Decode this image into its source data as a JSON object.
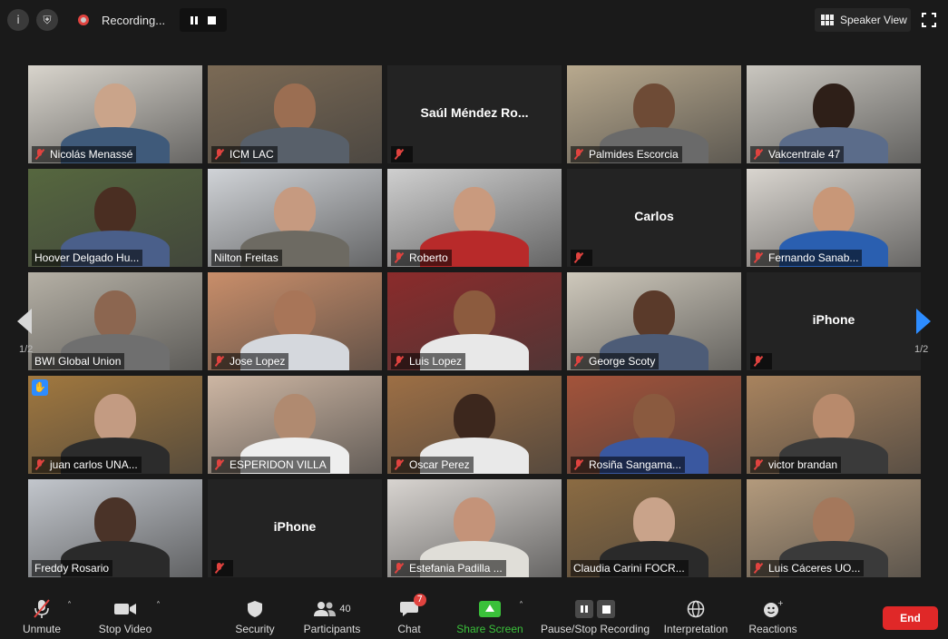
{
  "topbar": {
    "info_icon": "info-icon",
    "shield_icon": "shield-icon",
    "recording_text": "Recording...",
    "speaker_view_label": "Speaker View"
  },
  "participants": [
    {
      "name": "Nicolás Menassé",
      "video": true,
      "muted": true,
      "bg": "#d8d4cc",
      "skin": "#caa48a",
      "shirt": "#3f5a7a"
    },
    {
      "name": "ICM LAC",
      "video": true,
      "muted": true,
      "bg": "#7b6a55",
      "skin": "#9b6e52",
      "shirt": "#58606a"
    },
    {
      "name": "Saúl Méndez Ro...",
      "video": false,
      "muted": true,
      "label": "Saúl Méndez Ro..."
    },
    {
      "name": "Palmides Escorcia",
      "video": true,
      "muted": true,
      "bg": "#b8a98e",
      "skin": "#6e4b36",
      "shirt": "#6a6a6a"
    },
    {
      "name": "Vakcentrale 47",
      "video": true,
      "muted": true,
      "bg": "#c9c6bf",
      "skin": "#2e1f18",
      "shirt": "#5b6c8a"
    },
    {
      "name": "Hoover Delgado Hu...",
      "video": true,
      "muted": false,
      "active": true,
      "bg": "#56673f",
      "skin": "#4a2e22",
      "shirt": "#4a5f8a"
    },
    {
      "name": "Nilton Freitas",
      "video": true,
      "muted": false,
      "bg": "#d0d3d7",
      "skin": "#c69a80",
      "shirt": "#6d6a62"
    },
    {
      "name": "Roberto",
      "video": true,
      "muted": true,
      "bg": "#cfcfcf",
      "skin": "#c99a7e",
      "shirt": "#b82a2a"
    },
    {
      "name": "Carlos",
      "video": false,
      "muted": true,
      "label": "Carlos"
    },
    {
      "name": "Fernando Sanab...",
      "video": true,
      "muted": true,
      "bg": "#d9d5cf",
      "skin": "#c89778",
      "shirt": "#2a5fb0"
    },
    {
      "name": "BWI Global Union",
      "video": true,
      "muted": false,
      "bg": "#b5b0a5",
      "skin": "#8c6650",
      "shirt": "#6f6f6f"
    },
    {
      "name": "Jose Lopez",
      "video": true,
      "muted": true,
      "bg": "#c98e6a",
      "skin": "#a87558",
      "shirt": "#d5d8dd"
    },
    {
      "name": "Luis Lopez",
      "video": true,
      "muted": true,
      "bg": "#8b2b2b",
      "skin": "#8c5b3e",
      "shirt": "#e8e8e8"
    },
    {
      "name": "George Scoty",
      "video": true,
      "muted": true,
      "bg": "#cfc9bc",
      "skin": "#5a3a2a",
      "shirt": "#4d5c77"
    },
    {
      "name": "iPhone",
      "video": false,
      "muted": true,
      "label": "iPhone"
    },
    {
      "name": "juan carlos UNA...",
      "video": true,
      "muted": true,
      "hand": true,
      "bg": "#a1783f",
      "skin": "#c39b82",
      "shirt": "#2c2c2c"
    },
    {
      "name": "ESPERIDON VILLA",
      "video": true,
      "muted": true,
      "bg": "#cdb6a3",
      "skin": "#b08a70",
      "shirt": "#eeeeee"
    },
    {
      "name": "Oscar Perez",
      "video": true,
      "muted": true,
      "bg": "#9d6f45",
      "skin": "#3c271d",
      "shirt": "#e9e9e9"
    },
    {
      "name": "Rosiña Sangama...",
      "video": true,
      "muted": true,
      "bg": "#a3533a",
      "skin": "#8a5a3f",
      "shirt": "#3a58a0"
    },
    {
      "name": "victor brandan",
      "video": true,
      "muted": true,
      "bg": "#a8835e",
      "skin": "#b88a6c",
      "shirt": "#3a3a3a"
    },
    {
      "name": "Freddy Rosario",
      "video": true,
      "muted": false,
      "bg": "#c2c6cc",
      "skin": "#4a3328",
      "shirt": "#2a2a2a"
    },
    {
      "name": "iPhone",
      "video": false,
      "muted": true,
      "label": "iPhone"
    },
    {
      "name": "Estefania Padilla ...",
      "video": true,
      "muted": true,
      "bg": "#d8d4d0",
      "skin": "#c49379",
      "shirt": "#e0ded8"
    },
    {
      "name": "Claudia Carini FOCR...",
      "video": true,
      "muted": false,
      "bg": "#8b6b42",
      "skin": "#c9a38a",
      "shirt": "#2a2a2a"
    },
    {
      "name": "Luis Cáceres UO...",
      "video": true,
      "muted": true,
      "bg": "#b39a7c",
      "skin": "#a4785c",
      "shirt": "#3a3a3a"
    }
  ],
  "pagination": {
    "left": "1/2",
    "right": "1/2"
  },
  "toolbar": {
    "unmute": "Unmute",
    "stop_video": "Stop Video",
    "security": "Security",
    "participants": "Participants",
    "participant_count": "40",
    "chat": "Chat",
    "chat_badge": "7",
    "share_screen": "Share Screen",
    "pause_stop_recording": "Pause/Stop Recording",
    "interpretation": "Interpretation",
    "reactions": "Reactions",
    "end": "End"
  }
}
